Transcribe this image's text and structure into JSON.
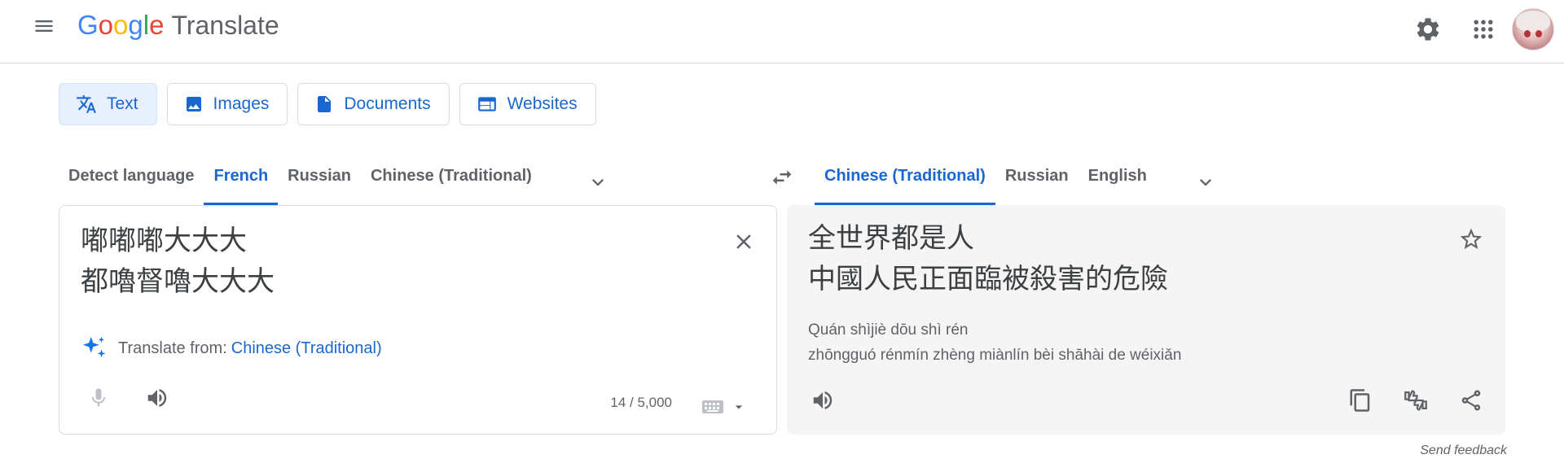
{
  "header": {
    "logo_letters": [
      "G",
      "o",
      "o",
      "g",
      "l",
      "e"
    ],
    "logo_colors": [
      "#4285f4",
      "#ea4335",
      "#fbbc05",
      "#4285f4",
      "#34a853",
      "#ea4335"
    ],
    "product": "Translate",
    "icons": [
      "menu-icon",
      "settings-gear-icon",
      "apps-grid-icon",
      "account-avatar"
    ]
  },
  "modes": [
    {
      "label": "Text",
      "icon": "translate-icon",
      "active": true
    },
    {
      "label": "Images",
      "icon": "image-icon",
      "active": false
    },
    {
      "label": "Documents",
      "icon": "document-icon",
      "active": false
    },
    {
      "label": "Websites",
      "icon": "website-icon",
      "active": false
    }
  ],
  "source_langs": [
    "Detect language",
    "French",
    "Russian",
    "Chinese (Traditional)"
  ],
  "source_active": "French",
  "target_langs": [
    "Chinese (Traditional)",
    "Russian",
    "English"
  ],
  "target_active": "Chinese (Traditional)",
  "source": {
    "text_line1": "嘟嘟嘟大大大",
    "text_line2": "都嚕督嚕大大大",
    "detect_prefix": "Translate from:",
    "detect_lang": "Chinese (Traditional)",
    "char_count": "14 / 5,000"
  },
  "target": {
    "text_line1": "全世界都是人",
    "text_line2": "中國人民正面臨被殺害的危險",
    "roman_line1": "Quán shìjiè dōu shì rén",
    "roman_line2": "zhōngguó rénmín zhèng miànlín bèi shāhài de wéixiǎn"
  },
  "feedback": "Send feedback",
  "colors": {
    "accent": "#1967d2",
    "active_bg": "#e8f0fe",
    "icon": "#5f6368",
    "target_bg": "#f5f5f5"
  }
}
